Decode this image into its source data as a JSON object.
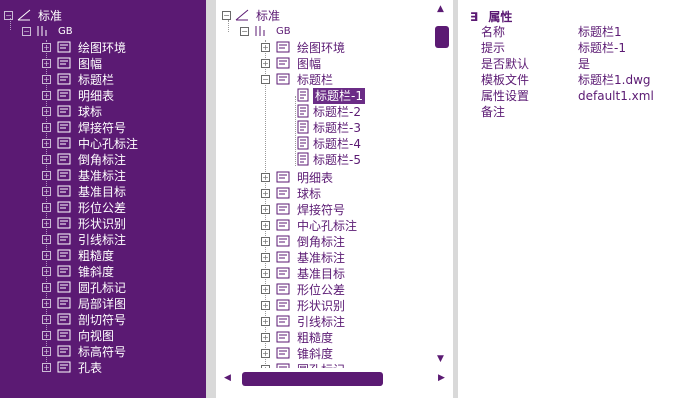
{
  "left_tree": {
    "root": "标准",
    "standard": "GB",
    "items": [
      "绘图环境",
      "图幅",
      "标题栏",
      "明细表",
      "球标",
      "焊接符号",
      "中心孔标注",
      "倒角标注",
      "基准标注",
      "基准目标",
      "形位公差",
      "形状识别",
      "引线标注",
      "粗糙度",
      "锥斜度",
      "圆孔标记",
      "局部详图",
      "剖切符号",
      "向视图",
      "标高符号",
      "孔表"
    ]
  },
  "mid_tree": {
    "root": "标准",
    "standard": "GB",
    "before_expanded": [
      "绘图环境",
      "图幅"
    ],
    "expanded": "标题栏",
    "children": [
      "标题栏-1",
      "标题栏-2",
      "标题栏-3",
      "标题栏-4",
      "标题栏-5"
    ],
    "selected_child_index": 0,
    "after_expanded": [
      "明细表",
      "球标",
      "焊接符号",
      "中心孔标注",
      "倒角标注",
      "基准标注",
      "基准目标",
      "形位公差",
      "形状识别",
      "引线标注",
      "粗糙度",
      "锥斜度",
      "圆孔标记"
    ]
  },
  "properties": {
    "header": "属性",
    "collapse_glyph": "∃",
    "rows": [
      {
        "name": "名称",
        "value": "标题栏1"
      },
      {
        "name": "提示",
        "value": "标题栏-1"
      },
      {
        "name": "是否默认",
        "value": "是"
      },
      {
        "name": "模板文件",
        "value": "标题栏1.dwg"
      },
      {
        "name": "属性设置",
        "value": "default1.xml"
      },
      {
        "name": "备注",
        "value": ""
      }
    ]
  },
  "icons": {
    "left_tree_item": "doc-symbol-icon",
    "root": "drawing-standard-icon"
  },
  "colors": {
    "accent": "#5b1a73",
    "panel_bg": "#ffffff",
    "gutter": "#d9d9d9"
  }
}
